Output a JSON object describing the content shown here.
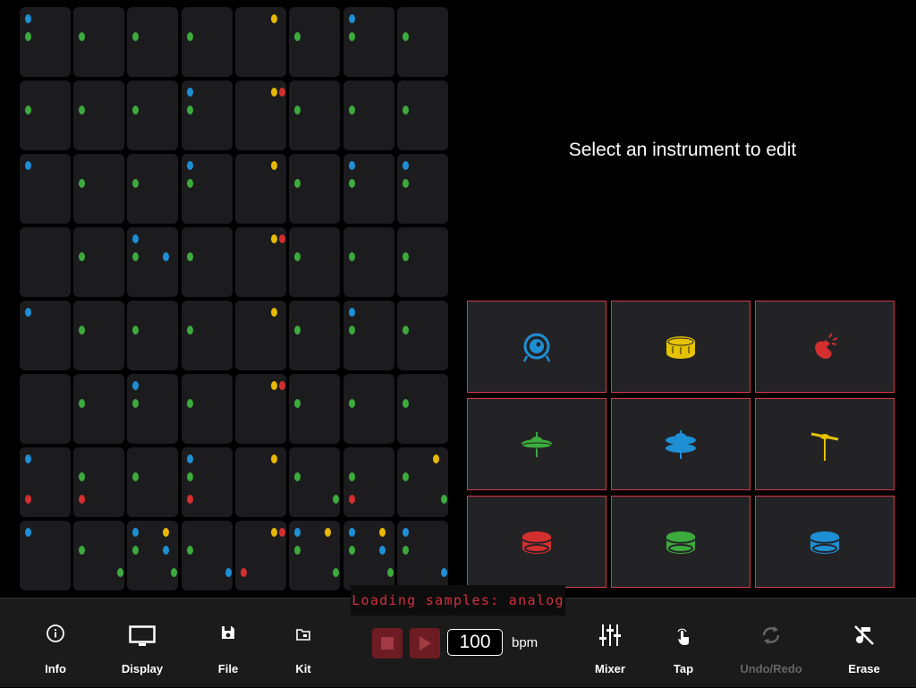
{
  "prompt": "Select an instrument to edit",
  "colors": {
    "blue": "#1e8fd4",
    "yellow": "#e6b800",
    "red": "#d42f2f",
    "green": "#3daa3d",
    "pad_border": "#d43a4a",
    "transport": "#6e1c24"
  },
  "grid": {
    "rows": 8,
    "cols": 8,
    "instruments_by_slot": {
      "a": "tom-high",
      "b": "cymbal-crash",
      "d": "hihat-closed",
      "e": "hihat-open",
      "f": "clap",
      "g": "snare",
      "h": "kick",
      "i": "tom-mid",
      "j": "tom-low"
    },
    "cells": [
      [
        "ad",
        "d",
        "d",
        "d",
        "b",
        "d",
        "ad",
        "d"
      ],
      [
        "d",
        "d",
        "d",
        "ad",
        "bf",
        "d",
        "d",
        "d"
      ],
      [
        "a",
        "d",
        "d",
        "ad",
        "b",
        "d",
        "ad",
        "ad"
      ],
      [
        "",
        "d",
        "ade",
        "d",
        "bf",
        "d",
        "d",
        "d"
      ],
      [
        "a",
        "d",
        "d",
        "d",
        "b",
        "d",
        "ad",
        "d"
      ],
      [
        "",
        "d",
        "ad",
        "d",
        "bf",
        "d",
        "d",
        "d"
      ],
      [
        "ah",
        "dh",
        "d",
        "adh",
        "b",
        "di",
        "dh",
        "bdi"
      ],
      [
        "a",
        "di",
        "abdei",
        "dj",
        "bfh",
        "abdi",
        "abdei",
        "adj"
      ]
    ]
  },
  "pads": [
    {
      "name": "kick",
      "icon": "kick-drum-icon",
      "color": "#1e8fd4"
    },
    {
      "name": "snare",
      "icon": "snare-drum-icon",
      "color": "#e6c200"
    },
    {
      "name": "clap",
      "icon": "clap-icon",
      "color": "#d42f2f"
    },
    {
      "name": "hihat-closed",
      "icon": "closed-hihat-icon",
      "color": "#3daa3d"
    },
    {
      "name": "hihat-open",
      "icon": "open-hihat-icon",
      "color": "#1e8fd4"
    },
    {
      "name": "cymbal-crash",
      "icon": "crash-cymbal-icon",
      "color": "#e6c200"
    },
    {
      "name": "tom-high",
      "icon": "tom-icon",
      "color": "#d42f2f"
    },
    {
      "name": "tom-mid",
      "icon": "tom-icon",
      "color": "#3daa3d"
    },
    {
      "name": "tom-low",
      "icon": "tom-icon",
      "color": "#1e8fd4"
    }
  ],
  "toolbar": {
    "info": "Info",
    "display": "Display",
    "file": "File",
    "kit": "Kit",
    "mixer": "Mixer",
    "tap": "Tap",
    "undo_redo": "Undo/Redo",
    "erase": "Erase"
  },
  "loading_text": "Loading samples: analog",
  "tempo": {
    "value": "100",
    "unit": "bpm"
  }
}
